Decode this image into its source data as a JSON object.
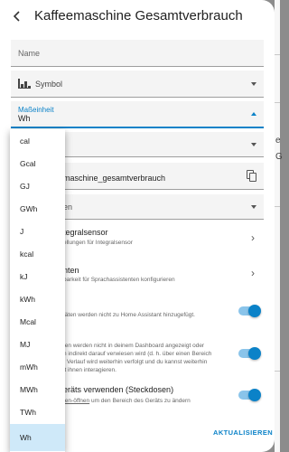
{
  "header": {
    "back_icon": "arrow-left-icon",
    "title": "Kaffeemaschine Gesamtverbrauch"
  },
  "name_field": {
    "label": "Name"
  },
  "symbol_field": {
    "icon": "chart-bar-icon",
    "label": "Symbol"
  },
  "unit_field": {
    "label": "Maßeinheit",
    "value": "Wh"
  },
  "entity_field": {
    "value_visible": "maschine_gesamtverbrauch",
    "copy_icon": "copy-icon"
  },
  "area_field": {
    "value_visible": "en"
  },
  "integral_row": {
    "title": "tegralsensor",
    "subtitle": "ellungen für Integralsensor"
  },
  "voice_row": {
    "title": "nten",
    "subtitle": "barkeit für Sprachassistenten konfigurieren"
  },
  "enabled_row": {
    "subtitle": "täten werden nicht zu Home Assistant hinzugefügt.",
    "toggle": true
  },
  "visible_row": {
    "subtitle_lines": [
      "ten werden nicht in deinem Dashboard angezeigt oder",
      "n indirekt darauf verwiesen wird (d. h. über einen Bereich",
      "r Verlauf wird weiterhin verfolgt und du kannst weiterhin",
      "it ihnen interagieren."
    ],
    "toggle": true
  },
  "device_area_row": {
    "title": "eräts verwenden (Steckdosen)",
    "subtitle_pre": "ten-öffnen",
    "subtitle_post": " um den Bereich des Geräts zu ändern",
    "toggle": true
  },
  "actions": {
    "update_label": "AKTUALISIEREN"
  },
  "right_strip": {
    "chars": [
      "e",
      "G"
    ]
  },
  "unit_options": [
    "cal",
    "Gcal",
    "GJ",
    "GWh",
    "J",
    "kcal",
    "kJ",
    "kWh",
    "Mcal",
    "MJ",
    "mWh",
    "MWh",
    "TWh",
    "Wh"
  ],
  "selected_unit": "Wh",
  "colors": {
    "accent": "#0b82c8",
    "selected_bg": "#cfe9f9"
  }
}
